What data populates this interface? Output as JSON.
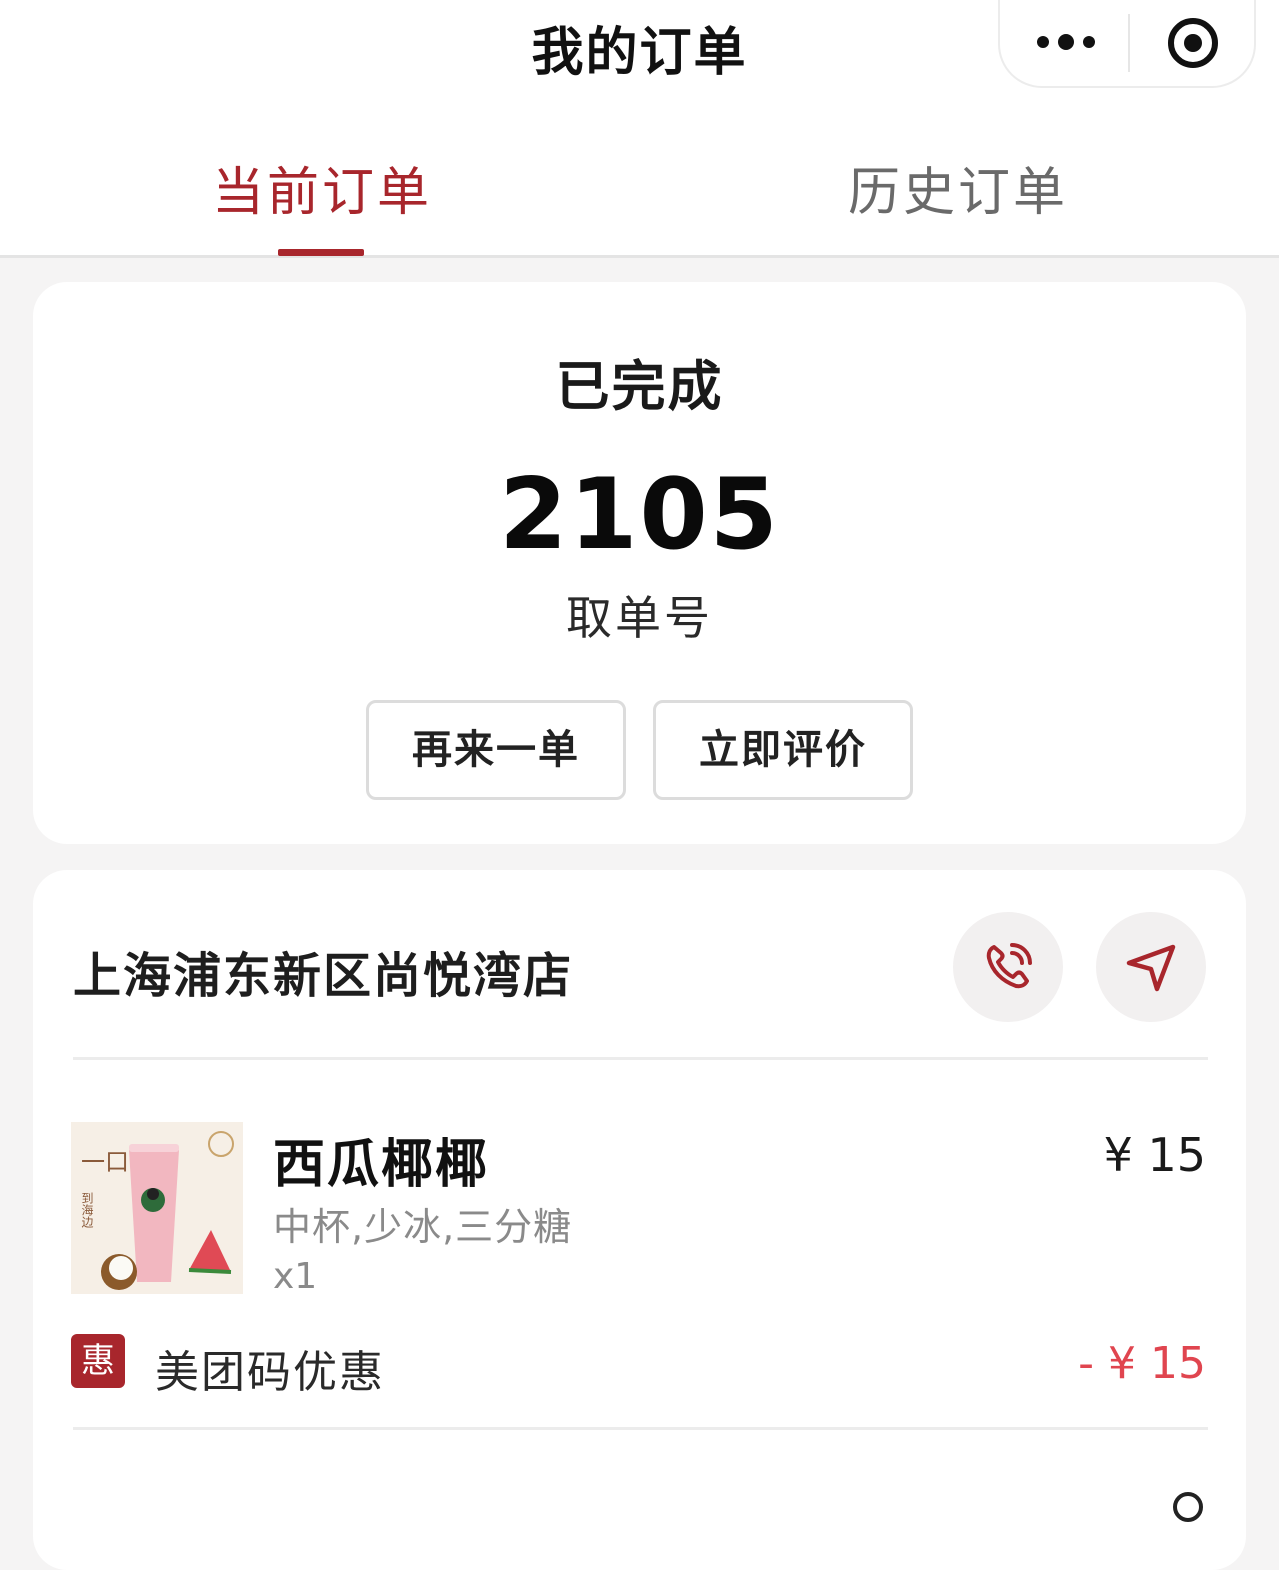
{
  "nav": {
    "title": "我的订单"
  },
  "capsule": {
    "more_icon": "more-dots-icon",
    "close_icon": "target-circle-icon"
  },
  "tabs": [
    {
      "label": "当前订单",
      "active": true
    },
    {
      "label": "历史订单",
      "active": false
    }
  ],
  "status_card": {
    "status": "已完成",
    "pickup_number": "2105",
    "pickup_label": "取单号",
    "buttons": {
      "reorder": "再来一单",
      "review": "立即评价"
    }
  },
  "order": {
    "store_name": "上海浦东新区尚悦湾店",
    "call_icon": "phone-call-icon",
    "navigate_icon": "navigation-arrow-icon",
    "item": {
      "name": "西瓜椰椰",
      "options": "中杯,少冰,三分糖",
      "quantity": "x1",
      "price": "¥ 15",
      "image_text": {
        "top": "一口",
        "side": "到海边"
      }
    },
    "discount": {
      "badge": "惠",
      "label": "美团码优惠",
      "amount": "- ¥ 15"
    }
  },
  "colors": {
    "accent": "#a8262c",
    "discount": "#e0454f",
    "background": "#f5f4f4"
  }
}
